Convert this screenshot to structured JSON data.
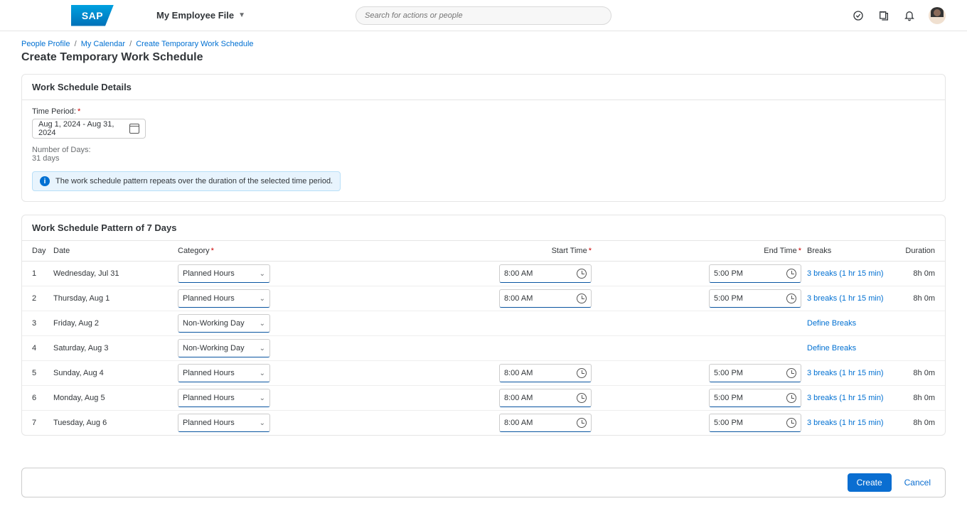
{
  "header": {
    "logo_text": "SAP",
    "menu_label": "My Employee File",
    "search_placeholder": "Search for actions or people"
  },
  "breadcrumb": {
    "items": [
      "People Profile",
      "My Calendar",
      "Create Temporary Work Schedule"
    ]
  },
  "page_title": "Create Temporary Work Schedule",
  "details": {
    "section_title": "Work Schedule Details",
    "time_period_label": "Time Period:",
    "time_period_value": "Aug 1, 2024 - Aug 31, 2024",
    "num_days_label": "Number of Days:",
    "num_days_value": "31 days",
    "info_text": "The work schedule pattern repeats over the duration of the selected time period."
  },
  "pattern": {
    "section_title": "Work Schedule Pattern of 7 Days",
    "columns": {
      "day": "Day",
      "date": "Date",
      "category": "Category",
      "start": "Start Time",
      "end": "End Time",
      "breaks": "Breaks",
      "duration": "Duration"
    },
    "rows": [
      {
        "day": "1",
        "date": "Wednesday, Jul 31",
        "category": "Planned Hours",
        "start": "8:00 AM",
        "end": "5:00 PM",
        "breaks": "3 breaks (1 hr 15 min)",
        "duration": "8h 0m"
      },
      {
        "day": "2",
        "date": "Thursday, Aug 1",
        "category": "Planned Hours",
        "start": "8:00 AM",
        "end": "5:00 PM",
        "breaks": "3 breaks (1 hr 15 min)",
        "duration": "8h 0m"
      },
      {
        "day": "3",
        "date": "Friday, Aug 2",
        "category": "Non-Working Day",
        "start": "",
        "end": "",
        "breaks": "Define Breaks",
        "duration": ""
      },
      {
        "day": "4",
        "date": "Saturday, Aug 3",
        "category": "Non-Working Day",
        "start": "",
        "end": "",
        "breaks": "Define Breaks",
        "duration": ""
      },
      {
        "day": "5",
        "date": "Sunday, Aug 4",
        "category": "Planned Hours",
        "start": "8:00 AM",
        "end": "5:00 PM",
        "breaks": "3 breaks (1 hr 15 min)",
        "duration": "8h 0m"
      },
      {
        "day": "6",
        "date": "Monday, Aug 5",
        "category": "Planned Hours",
        "start": "8:00 AM",
        "end": "5:00 PM",
        "breaks": "3 breaks (1 hr 15 min)",
        "duration": "8h 0m"
      },
      {
        "day": "7",
        "date": "Tuesday, Aug 6",
        "category": "Planned Hours",
        "start": "8:00 AM",
        "end": "5:00 PM",
        "breaks": "3 breaks (1 hr 15 min)",
        "duration": "8h 0m"
      }
    ]
  },
  "footer": {
    "create_label": "Create",
    "cancel_label": "Cancel"
  }
}
